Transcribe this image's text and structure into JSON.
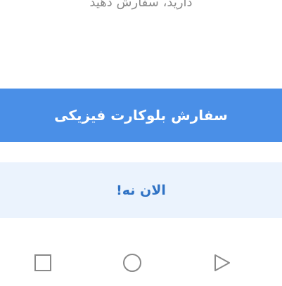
{
  "dialog": {
    "top_text_partial": "دارید، سفارش دهید",
    "primary_button_label": "سفارش بلوکارت فیزیکی",
    "secondary_button_label": "الان نه!"
  },
  "navbar": {
    "icons": [
      "square-icon",
      "circle-icon",
      "triangle-icon"
    ]
  },
  "colors": {
    "primary": "#4a8fe7",
    "secondary_bg": "#ebf3fd",
    "secondary_text": "#2f72c4",
    "nav_icon": "#8a8a8a"
  }
}
